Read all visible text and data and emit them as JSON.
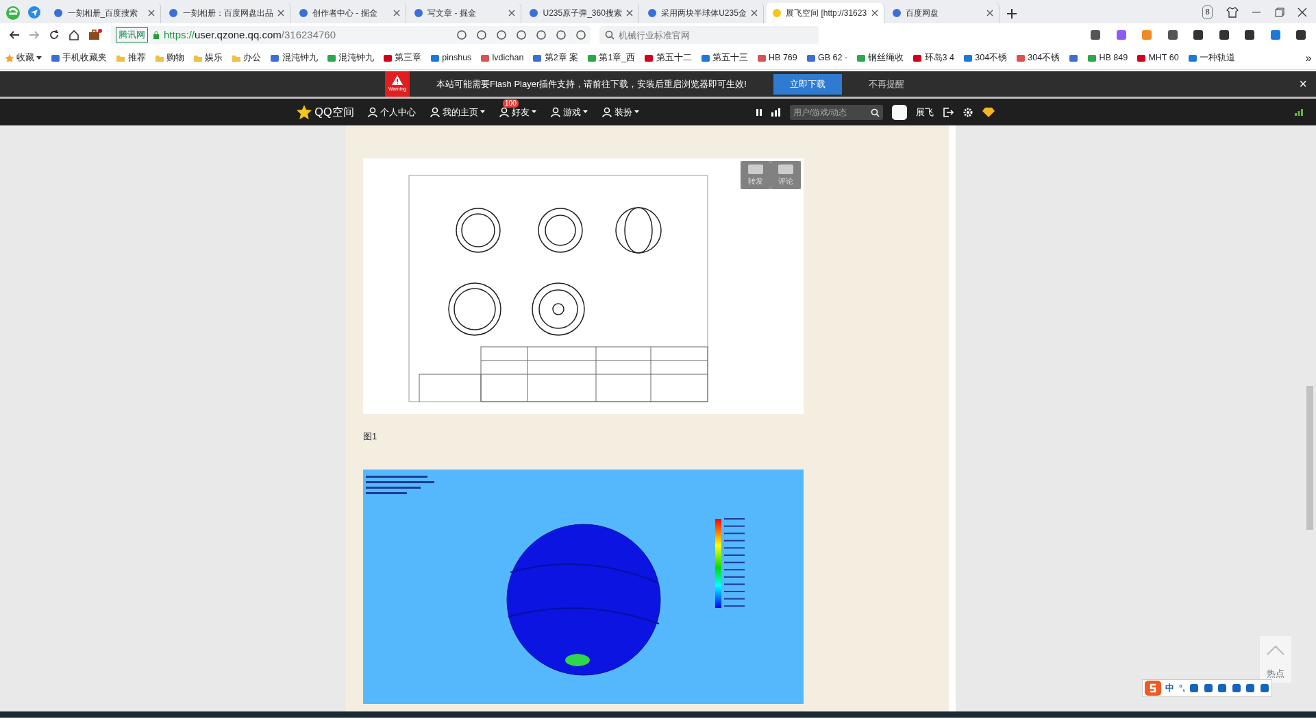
{
  "browser": {
    "tabs": [
      {
        "title": "一刻相册_百度搜索",
        "selected": false
      },
      {
        "title": "一刻相册：百度网盘出品",
        "selected": false
      },
      {
        "title": "创作者中心 - 掘金",
        "selected": false
      },
      {
        "title": "写文章 - 掘金",
        "selected": false
      },
      {
        "title": "U235原子弹_360搜索",
        "selected": false
      },
      {
        "title": "采用两块半球体U235金",
        "selected": false
      },
      {
        "title": "展飞空间 [http://31623",
        "selected": true
      },
      {
        "title": "百度网盘",
        "selected": false
      }
    ],
    "tab_count": "8",
    "address": {
      "site_badge": "腾讯网",
      "scheme": "https://",
      "host": "user.qzone.qq.com",
      "path": "/316234760"
    },
    "search": {
      "placeholder": "机械行业标准官网"
    },
    "bookmarks": [
      {
        "kind": "favorites",
        "label": "收藏"
      },
      {
        "kind": "site",
        "label": "手机收藏夹"
      },
      {
        "kind": "folder",
        "label": "推荐"
      },
      {
        "kind": "folder",
        "label": "购物"
      },
      {
        "kind": "folder",
        "label": "娱乐"
      },
      {
        "kind": "folder",
        "label": "办公"
      },
      {
        "kind": "site",
        "label": "混沌钟九"
      },
      {
        "kind": "site",
        "label": "混沌钟九"
      },
      {
        "kind": "site",
        "label": "第三章"
      },
      {
        "kind": "site",
        "label": "pinshus"
      },
      {
        "kind": "site",
        "label": "lvdichan"
      },
      {
        "kind": "site",
        "label": "第2章 案"
      },
      {
        "kind": "site",
        "label": "第1章_西"
      },
      {
        "kind": "site",
        "label": "第五十二"
      },
      {
        "kind": "site",
        "label": "第五十三"
      },
      {
        "kind": "site",
        "label": "HB 769"
      },
      {
        "kind": "site",
        "label": "GB 62 -"
      },
      {
        "kind": "site",
        "label": "钢丝绳收"
      },
      {
        "kind": "site",
        "label": "环岛3 4"
      },
      {
        "kind": "site",
        "label": "304不锈"
      },
      {
        "kind": "site",
        "label": "304不锈"
      },
      {
        "kind": "icon_only"
      },
      {
        "kind": "site",
        "label": "HB 849"
      },
      {
        "kind": "site",
        "label": "MHT 60"
      },
      {
        "kind": "site",
        "label": "一种轨道"
      }
    ],
    "bookmarks_more": "»"
  },
  "flash_bar": {
    "warning": "Warning",
    "message": "本站可能需要Flash Player插件支持，请前往下载，安装后重启浏览器即可生效!",
    "download": "立即下载",
    "dismiss": "不再提醒",
    "close": "×"
  },
  "qzone_nav": {
    "logo": "QQ空间",
    "items": [
      {
        "label": "个人中心",
        "dropdown": false
      },
      {
        "label": "我的主页",
        "dropdown": true
      },
      {
        "label": "好友",
        "dropdown": true,
        "badge": "100"
      },
      {
        "label": "游戏",
        "dropdown": true
      },
      {
        "label": "装扮",
        "dropdown": true
      }
    ],
    "search": {
      "placeholder": "用户/游戏/动态"
    },
    "user": "展飞"
  },
  "post": {
    "figure_actions": [
      "转发",
      "评论"
    ],
    "caption": "图1"
  },
  "side": {
    "hot": "热点"
  },
  "ime": {
    "mode": "中",
    "punct": "°,"
  }
}
